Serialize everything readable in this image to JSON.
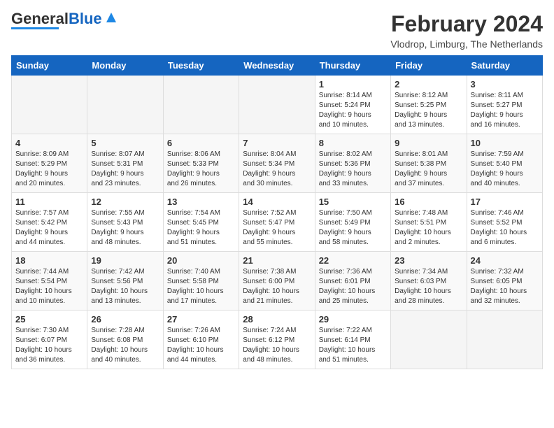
{
  "header": {
    "logo_general": "General",
    "logo_blue": "Blue",
    "month_year": "February 2024",
    "location": "Vlodrop, Limburg, The Netherlands"
  },
  "days_of_week": [
    "Sunday",
    "Monday",
    "Tuesday",
    "Wednesday",
    "Thursday",
    "Friday",
    "Saturday"
  ],
  "weeks": [
    [
      {
        "day": "",
        "info": ""
      },
      {
        "day": "",
        "info": ""
      },
      {
        "day": "",
        "info": ""
      },
      {
        "day": "",
        "info": ""
      },
      {
        "day": "1",
        "info": "Sunrise: 8:14 AM\nSunset: 5:24 PM\nDaylight: 9 hours\nand 10 minutes."
      },
      {
        "day": "2",
        "info": "Sunrise: 8:12 AM\nSunset: 5:25 PM\nDaylight: 9 hours\nand 13 minutes."
      },
      {
        "day": "3",
        "info": "Sunrise: 8:11 AM\nSunset: 5:27 PM\nDaylight: 9 hours\nand 16 minutes."
      }
    ],
    [
      {
        "day": "4",
        "info": "Sunrise: 8:09 AM\nSunset: 5:29 PM\nDaylight: 9 hours\nand 20 minutes."
      },
      {
        "day": "5",
        "info": "Sunrise: 8:07 AM\nSunset: 5:31 PM\nDaylight: 9 hours\nand 23 minutes."
      },
      {
        "day": "6",
        "info": "Sunrise: 8:06 AM\nSunset: 5:33 PM\nDaylight: 9 hours\nand 26 minutes."
      },
      {
        "day": "7",
        "info": "Sunrise: 8:04 AM\nSunset: 5:34 PM\nDaylight: 9 hours\nand 30 minutes."
      },
      {
        "day": "8",
        "info": "Sunrise: 8:02 AM\nSunset: 5:36 PM\nDaylight: 9 hours\nand 33 minutes."
      },
      {
        "day": "9",
        "info": "Sunrise: 8:01 AM\nSunset: 5:38 PM\nDaylight: 9 hours\nand 37 minutes."
      },
      {
        "day": "10",
        "info": "Sunrise: 7:59 AM\nSunset: 5:40 PM\nDaylight: 9 hours\nand 40 minutes."
      }
    ],
    [
      {
        "day": "11",
        "info": "Sunrise: 7:57 AM\nSunset: 5:42 PM\nDaylight: 9 hours\nand 44 minutes."
      },
      {
        "day": "12",
        "info": "Sunrise: 7:55 AM\nSunset: 5:43 PM\nDaylight: 9 hours\nand 48 minutes."
      },
      {
        "day": "13",
        "info": "Sunrise: 7:54 AM\nSunset: 5:45 PM\nDaylight: 9 hours\nand 51 minutes."
      },
      {
        "day": "14",
        "info": "Sunrise: 7:52 AM\nSunset: 5:47 PM\nDaylight: 9 hours\nand 55 minutes."
      },
      {
        "day": "15",
        "info": "Sunrise: 7:50 AM\nSunset: 5:49 PM\nDaylight: 9 hours\nand 58 minutes."
      },
      {
        "day": "16",
        "info": "Sunrise: 7:48 AM\nSunset: 5:51 PM\nDaylight: 10 hours\nand 2 minutes."
      },
      {
        "day": "17",
        "info": "Sunrise: 7:46 AM\nSunset: 5:52 PM\nDaylight: 10 hours\nand 6 minutes."
      }
    ],
    [
      {
        "day": "18",
        "info": "Sunrise: 7:44 AM\nSunset: 5:54 PM\nDaylight: 10 hours\nand 10 minutes."
      },
      {
        "day": "19",
        "info": "Sunrise: 7:42 AM\nSunset: 5:56 PM\nDaylight: 10 hours\nand 13 minutes."
      },
      {
        "day": "20",
        "info": "Sunrise: 7:40 AM\nSunset: 5:58 PM\nDaylight: 10 hours\nand 17 minutes."
      },
      {
        "day": "21",
        "info": "Sunrise: 7:38 AM\nSunset: 6:00 PM\nDaylight: 10 hours\nand 21 minutes."
      },
      {
        "day": "22",
        "info": "Sunrise: 7:36 AM\nSunset: 6:01 PM\nDaylight: 10 hours\nand 25 minutes."
      },
      {
        "day": "23",
        "info": "Sunrise: 7:34 AM\nSunset: 6:03 PM\nDaylight: 10 hours\nand 28 minutes."
      },
      {
        "day": "24",
        "info": "Sunrise: 7:32 AM\nSunset: 6:05 PM\nDaylight: 10 hours\nand 32 minutes."
      }
    ],
    [
      {
        "day": "25",
        "info": "Sunrise: 7:30 AM\nSunset: 6:07 PM\nDaylight: 10 hours\nand 36 minutes."
      },
      {
        "day": "26",
        "info": "Sunrise: 7:28 AM\nSunset: 6:08 PM\nDaylight: 10 hours\nand 40 minutes."
      },
      {
        "day": "27",
        "info": "Sunrise: 7:26 AM\nSunset: 6:10 PM\nDaylight: 10 hours\nand 44 minutes."
      },
      {
        "day": "28",
        "info": "Sunrise: 7:24 AM\nSunset: 6:12 PM\nDaylight: 10 hours\nand 48 minutes."
      },
      {
        "day": "29",
        "info": "Sunrise: 7:22 AM\nSunset: 6:14 PM\nDaylight: 10 hours\nand 51 minutes."
      },
      {
        "day": "",
        "info": ""
      },
      {
        "day": "",
        "info": ""
      }
    ]
  ]
}
